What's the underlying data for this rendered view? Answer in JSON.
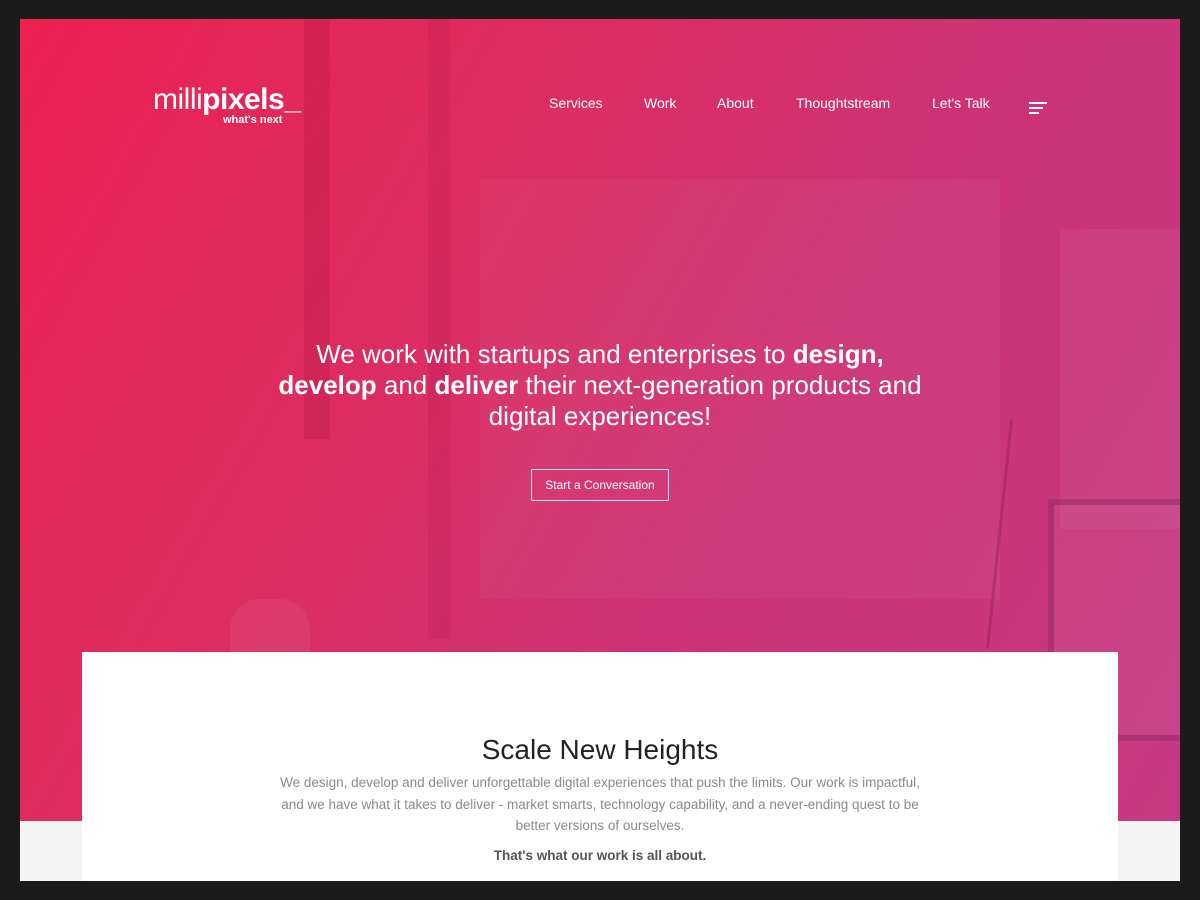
{
  "brand": {
    "logo_light": "milli",
    "logo_bold": "pixels",
    "logo_cursor": "_",
    "tagline": "what's next"
  },
  "nav": {
    "items": [
      {
        "label": "Services"
      },
      {
        "label": "Work"
      },
      {
        "label": "About"
      },
      {
        "label": "Thoughtstream"
      },
      {
        "label": "Let's Talk"
      }
    ],
    "menu_icon": "hamburger-menu-icon"
  },
  "hero": {
    "text_1": "We work with startups and enterprises to ",
    "text_2": "design,",
    "text_3": "develop",
    "text_4": " and ",
    "text_5": "deliver",
    "text_6": " their next-generation products and digital experiences!",
    "cta_label": "Start a Conversation"
  },
  "intro": {
    "title": "Scale New Heights",
    "body": "We design, develop and deliver unforgettable digital experiences that push the limits. Our work is impactful, and we have what it takes to deliver - market smarts, technology capability, and a never-ending quest to be better versions of ourselves.",
    "tagline": "That's what our work is all about."
  },
  "colors": {
    "hero_gradient_start": "#ec2150",
    "hero_gradient_end": "#c63a83",
    "frame_background": "#1b1b1b",
    "card_background": "#ffffff"
  }
}
